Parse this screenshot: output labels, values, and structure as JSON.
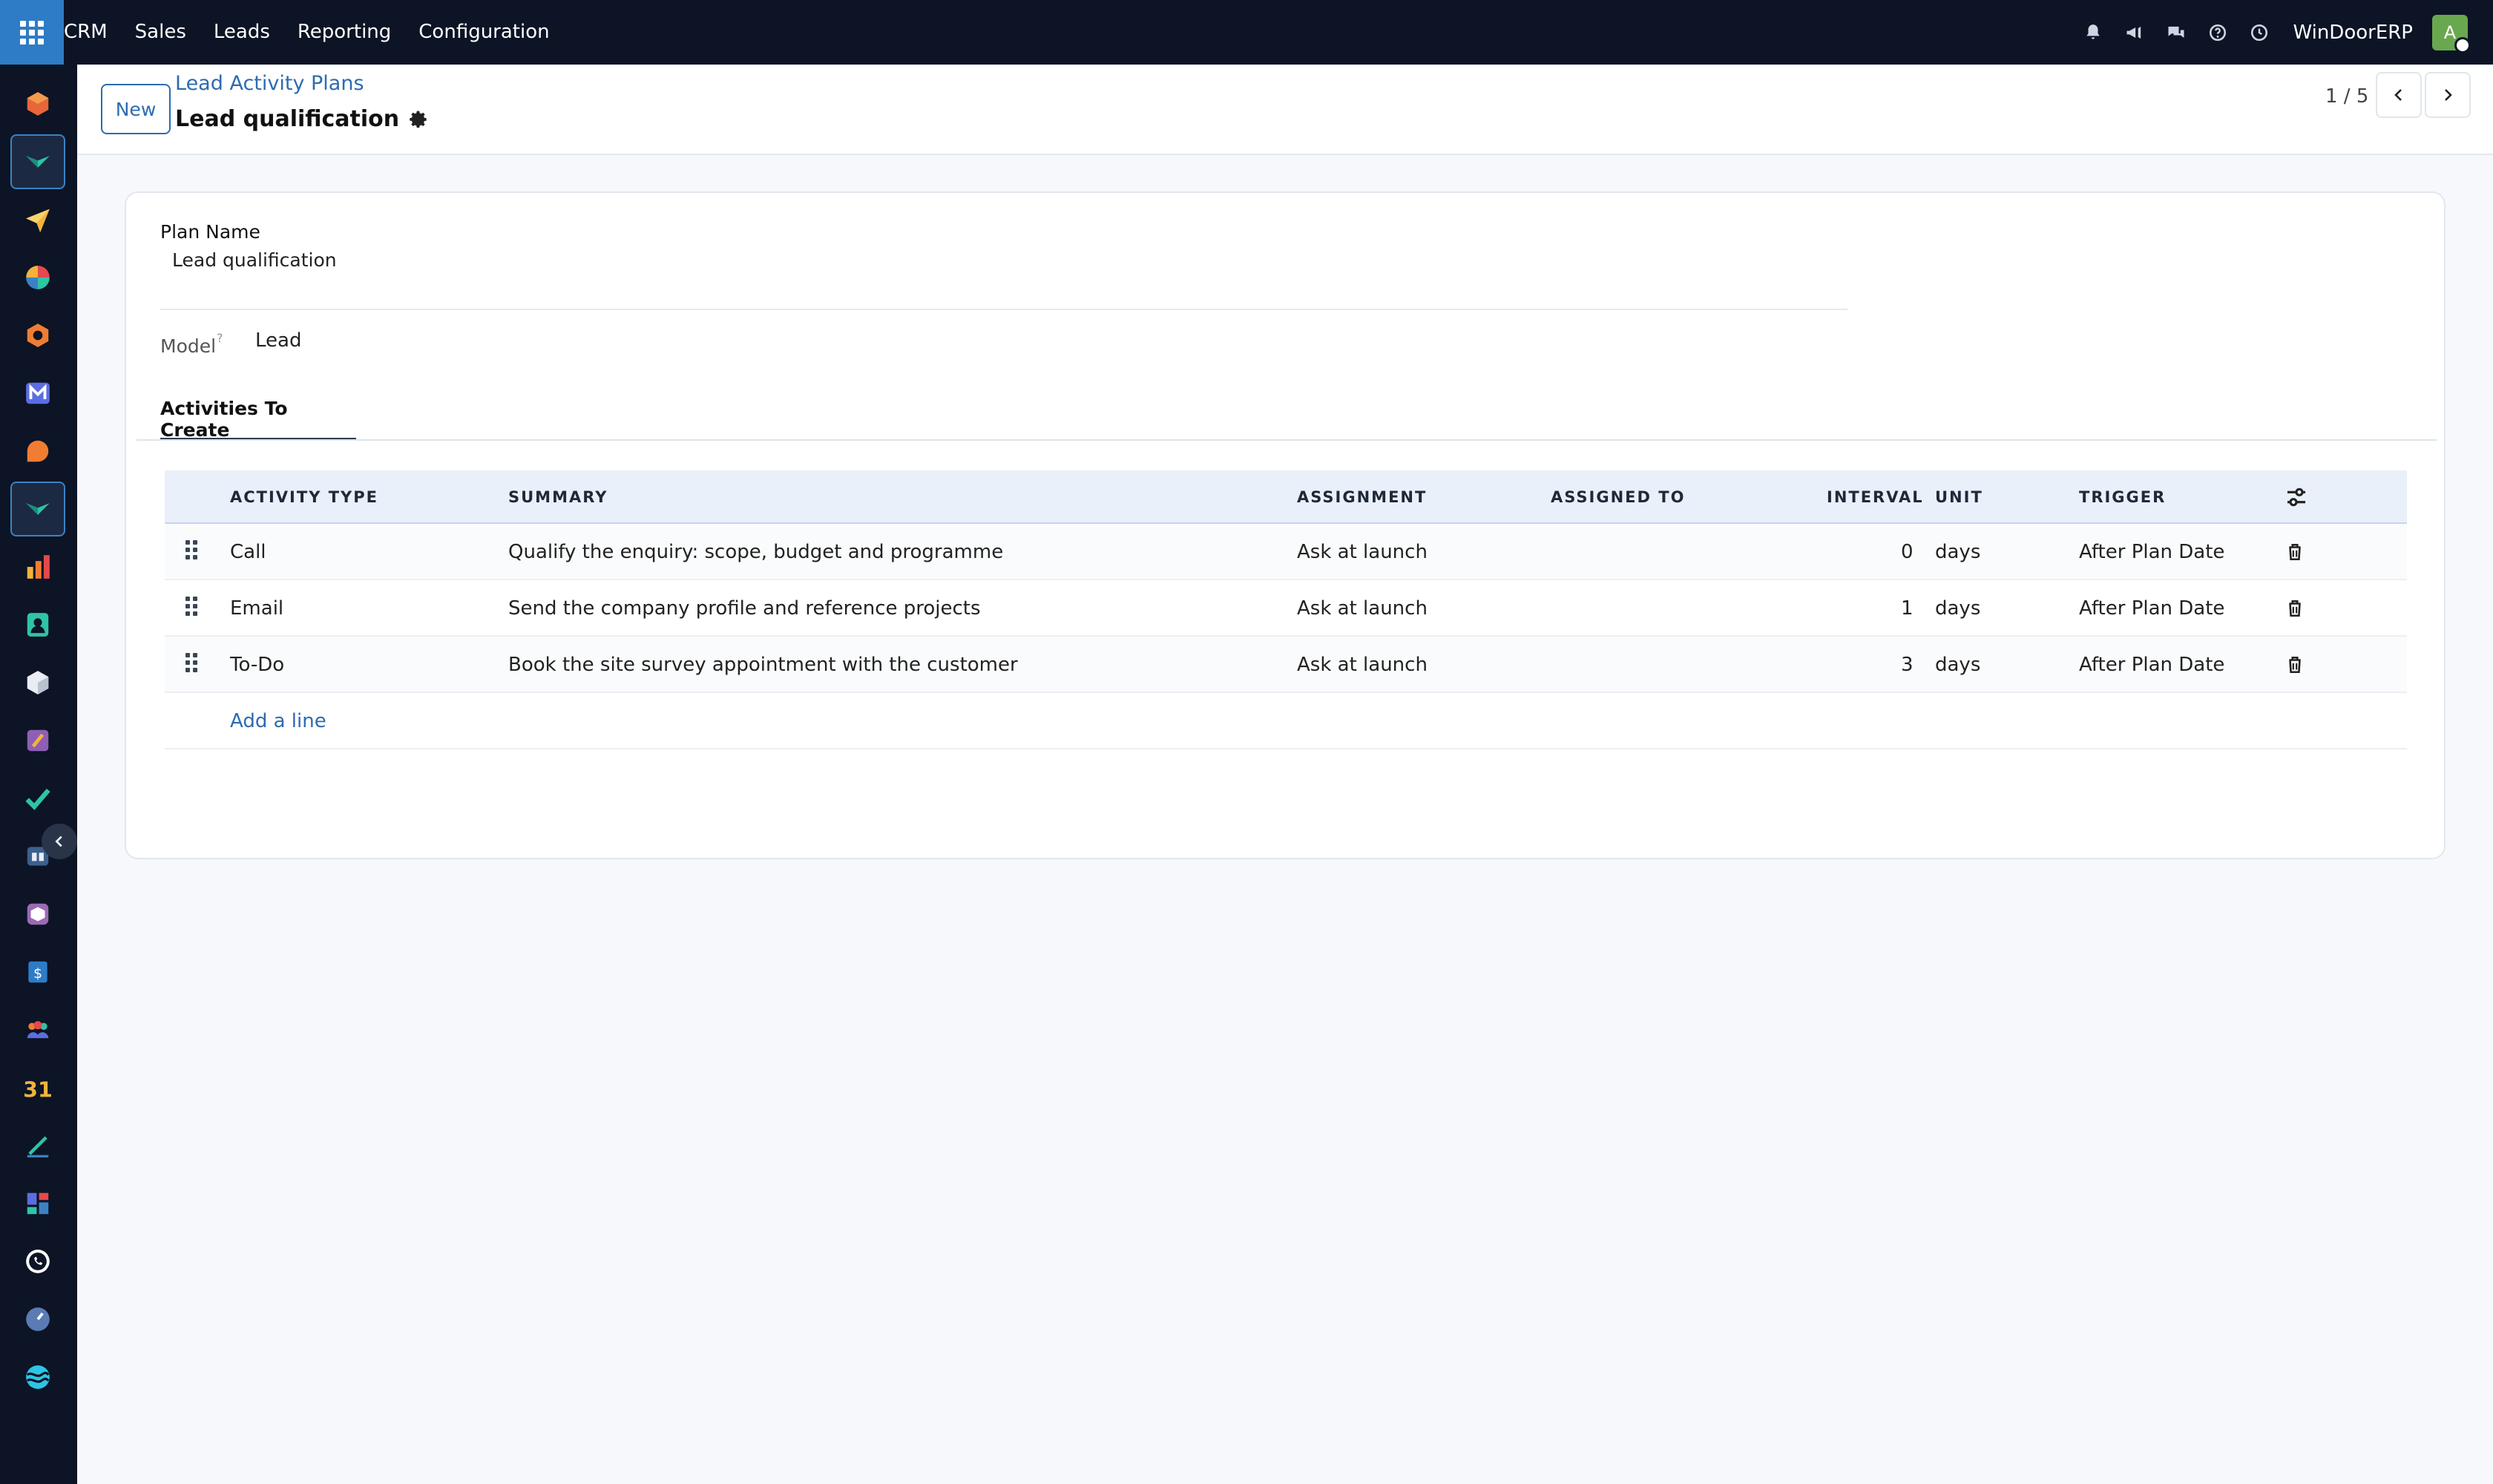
{
  "nav": {
    "menu": [
      "CRM",
      "Sales",
      "Leads",
      "Reporting",
      "Configuration"
    ],
    "company": "WinDoorERP",
    "avatar_initial": "A",
    "accent": "#2e7cc5"
  },
  "sidebar": {
    "icons": [
      "hexagon-icon",
      "crm-icon",
      "send-icon",
      "pie-icon",
      "gear-hex-icon",
      "mail-icon",
      "chat-icon",
      "crm-icon",
      "chart-icon",
      "contact-icon",
      "cube-icon",
      "paint-icon",
      "check-icon",
      "book-icon",
      "box-icon",
      "dollar-icon",
      "team-icon",
      "calendar-icon",
      "sign-icon",
      "dashboard-icon",
      "whatsapp-icon",
      "compass-icon",
      "wave-icon"
    ],
    "calendar_day": "31"
  },
  "control": {
    "new_label": "New",
    "breadcrumb": "Lead Activity Plans",
    "record_title": "Lead qualification",
    "pager": "1 / 5"
  },
  "form": {
    "plan_name_label": "Plan Name",
    "plan_name_value": "Lead qualification",
    "model_label": "Model",
    "model_help": "?",
    "model_value": "Lead",
    "tab_label": "Activities To Create"
  },
  "table": {
    "columns": [
      "ACTIVITY TYPE",
      "SUMMARY",
      "ASSIGNMENT",
      "ASSIGNED TO",
      "INTERVAL",
      "UNIT",
      "TRIGGER"
    ],
    "rows": [
      {
        "type": "Call",
        "summary": "Qualify the enquiry: scope, budget and programme",
        "assignment": "Ask at launch",
        "assigned_to": "",
        "interval": "0",
        "unit": "days",
        "trigger": "After Plan Date"
      },
      {
        "type": "Email",
        "summary": "Send the company profile and reference projects",
        "assignment": "Ask at launch",
        "assigned_to": "",
        "interval": "1",
        "unit": "days",
        "trigger": "After Plan Date"
      },
      {
        "type": "To-Do",
        "summary": "Book the site survey appointment with the customer",
        "assignment": "Ask at launch",
        "assigned_to": "",
        "interval": "3",
        "unit": "days",
        "trigger": "After Plan Date"
      }
    ],
    "add_line_label": "Add a line"
  }
}
